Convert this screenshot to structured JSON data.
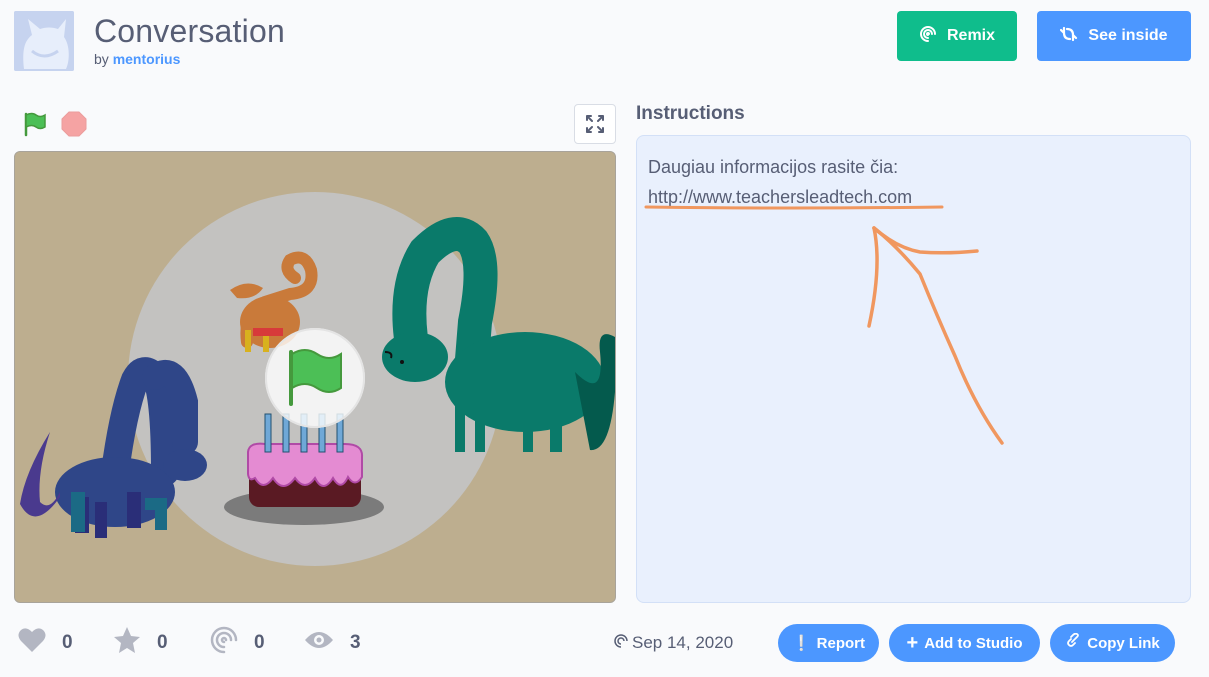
{
  "project": {
    "title": "Conversation",
    "by_prefix": "by",
    "author": "mentorius"
  },
  "actions": {
    "remix_label": "Remix",
    "see_inside_label": "See inside"
  },
  "player": {
    "green_flag_icon": "green-flag-icon",
    "stop_icon": "stop-sign-icon",
    "fullscreen_icon": "fullscreen-icon"
  },
  "instructions": {
    "heading": "Instructions",
    "line1": "Daugiau informacijos rasite čia:",
    "link": "http://www.teachersleadtech.com"
  },
  "stats": {
    "loves": "0",
    "favorites": "0",
    "remixes": "0",
    "views": "3"
  },
  "shared_date": "Sep 14, 2020",
  "footer_buttons": {
    "report": "Report",
    "add_to_studio": "Add to Studio",
    "copy_link": "Copy Link"
  },
  "colors": {
    "remix_green": "#0fbd8c",
    "primary_blue": "#4c97ff",
    "text": "#575e75",
    "instructions_bg": "#e9f0fd",
    "annotation_orange": "#f0975f"
  }
}
